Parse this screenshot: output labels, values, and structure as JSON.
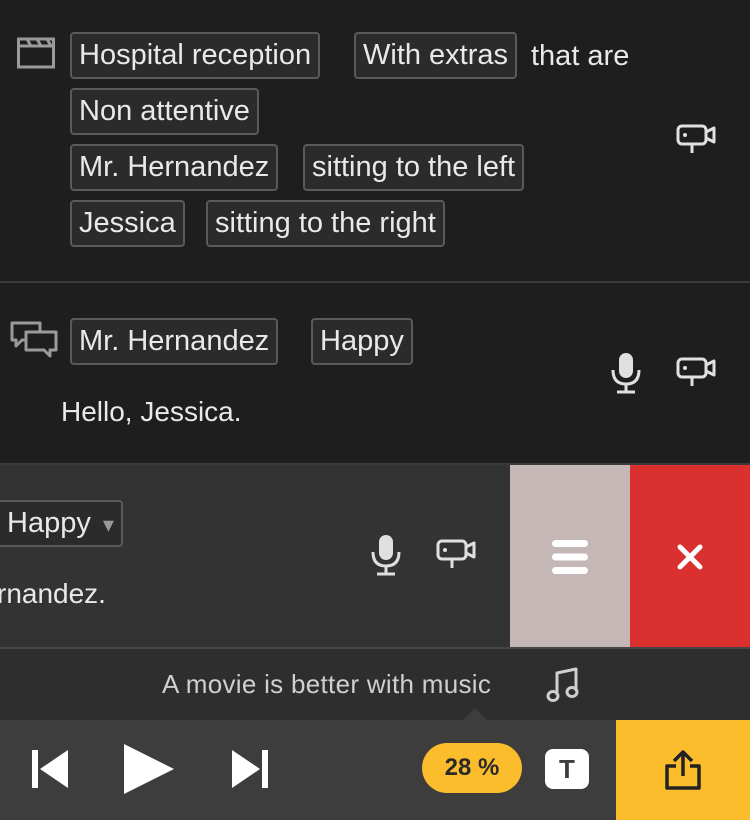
{
  "scene": {
    "icon": "clapperboard-icon",
    "location_tag": "Hospital reception",
    "extras_tag": "With extras",
    "extras_connector": "that are",
    "extras_state_tag": "Non attentive",
    "character1_tag": "Mr. Hernandez",
    "character1_position_tag": "sitting to the left",
    "character2_tag": "Jessica",
    "character2_position_tag": "sitting to the right",
    "camera_icon": "camera-icon"
  },
  "dialogue1": {
    "icon": "speech-bubbles-icon",
    "character_tag": "Mr. Hernandez",
    "mood_tag": "Happy",
    "line": "Hello, Jessica.",
    "mic_icon": "microphone-icon",
    "camera_icon": "camera-icon"
  },
  "dialogue2": {
    "mood_tag": "Happy",
    "mood_caret": "▾",
    "line": "rnandez.",
    "mic_icon": "microphone-icon",
    "camera_icon": "camera-icon",
    "reorder_icon": "hamburger-icon",
    "delete_icon": "close-icon"
  },
  "music": {
    "text": "A movie is better with music",
    "icon": "music-note-icon"
  },
  "player": {
    "progress_label": "28 %",
    "progress_value": 28,
    "text_button_label": "T",
    "share_icon": "share-icon"
  },
  "colors": {
    "accent": "#fbbd2c",
    "delete": "#db3030",
    "reorder": "#c6b7b7",
    "background": "#1e1e1e"
  }
}
